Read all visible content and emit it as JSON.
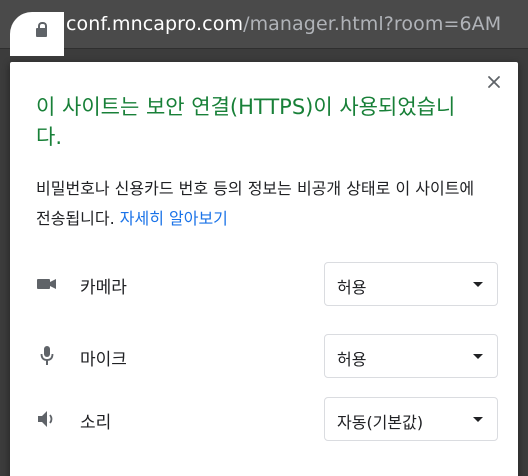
{
  "address_bar": {
    "domain": "conf.mncapro.com",
    "path": "/manager.html?room=6AM"
  },
  "popup": {
    "title": "이 사이트는 보안 연결(HTTPS)이 사용되었습니다.",
    "description": "비밀번호나 신용카드 번호 등의 정보는 비공개 상태로 이 사이트에 전송됩니다. ",
    "learn_more": "자세히 알아보기",
    "permissions": [
      {
        "icon": "camera-icon",
        "label": "카메라",
        "value": "허용"
      },
      {
        "icon": "microphone-icon",
        "label": "마이크",
        "value": "허용"
      },
      {
        "icon": "speaker-icon",
        "label": "소리",
        "value": "자동(기본값)"
      }
    ]
  },
  "colors": {
    "secure_title": "#188038",
    "link": "#1a73e8",
    "text": "#202124",
    "icon": "#5f6368"
  }
}
